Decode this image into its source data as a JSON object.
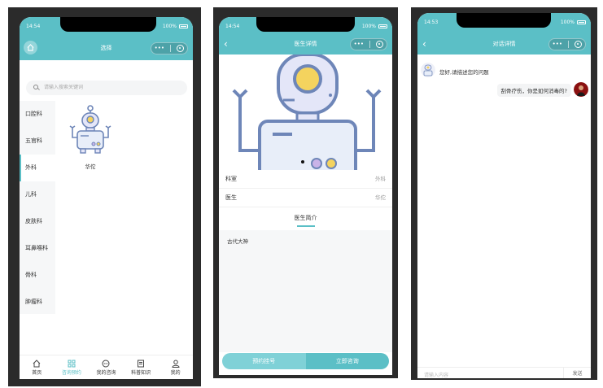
{
  "accent": "#5bbfc6",
  "screen1": {
    "status": {
      "time": "14:54",
      "battery": "100%"
    },
    "title": "选择",
    "search_placeholder": "请输入搜索关键词",
    "categories": [
      "口腔科",
      "五官科",
      "外科",
      "儿科",
      "皮肤科",
      "耳鼻喉科",
      "骨科",
      "肿瘤科"
    ],
    "active_category": "外科",
    "doctor_name": "华佗",
    "tabs": [
      {
        "label": "首页",
        "icon": "home-icon"
      },
      {
        "label": "咨询预约",
        "icon": "grid-icon"
      },
      {
        "label": "我的咨询",
        "icon": "chat-icon"
      },
      {
        "label": "科普知识",
        "icon": "book-icon"
      },
      {
        "label": "我的",
        "icon": "user-icon"
      }
    ],
    "active_tab": "咨询预约"
  },
  "screen2": {
    "status": {
      "time": "14:54",
      "battery": "100%"
    },
    "title": "医生详情",
    "rows": [
      {
        "label": "科室",
        "value": "外科"
      },
      {
        "label": "医生",
        "value": "华佗"
      }
    ],
    "intro_tab": "医生简介",
    "intro_text": "古代大神",
    "buttons": {
      "book": "预约挂号",
      "consult": "立即咨询"
    }
  },
  "screen3": {
    "status": {
      "time": "14:53",
      "battery": "100%"
    },
    "title": "对话详情",
    "messages": [
      {
        "from": "bot",
        "text": "您好,请描述您的问题"
      },
      {
        "from": "user",
        "text": "刮骨疗伤，你是如何消毒的?"
      }
    ],
    "input_placeholder": "请输入内容",
    "send_label": "发送"
  }
}
